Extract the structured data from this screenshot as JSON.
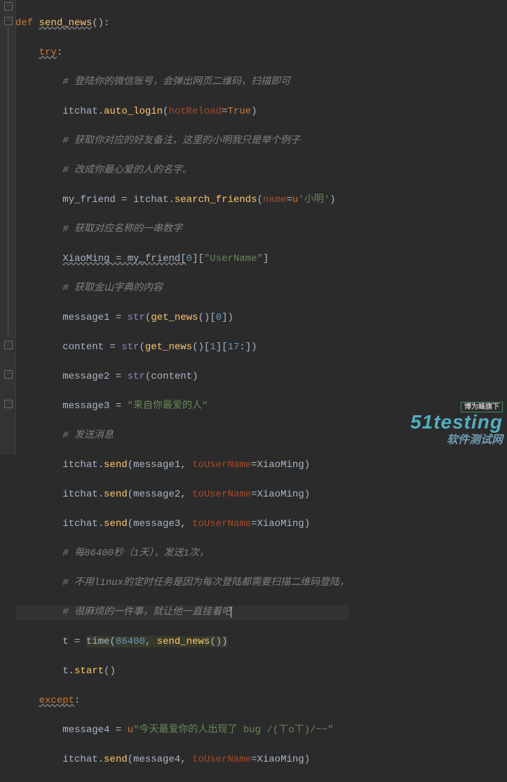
{
  "code": {
    "l1": {
      "kw": "def ",
      "fn": "send_news",
      "rest": "():"
    },
    "l2": {
      "kw": "try",
      "colon": ":"
    },
    "l3": "# 登陆你的微信账号，会弹出网页二维码，扫描即可",
    "l4": {
      "a": "itchat.",
      "fn": "auto_login",
      "b": "(",
      "p": "hotReload",
      "c": "=",
      "kw": "True",
      "d": ")"
    },
    "l5": "# 获取你对应的好友备注，这里的小明我只是举个例子",
    "l6": "# 改成你最心爱的人的名字。",
    "l7": {
      "a": "my_friend = itchat.",
      "fn": "search_friends",
      "b": "(",
      "p": "name",
      "c": "=",
      "kw": "u",
      "s": "'小明'",
      "d": ")"
    },
    "l8": "# 获取对应名称的一串数字",
    "l9": {
      "a": "XiaoMing = my_friend[",
      "n": "0",
      "b": "][",
      "s": "\"UserName\"",
      "c": "]"
    },
    "l10": "# 获取金山字典的内容",
    "l11": {
      "a": "message1 = ",
      "fn": "str",
      "b": "(",
      "fn2": "get_news",
      "c": "()[",
      "n": "0",
      "d": "])"
    },
    "l12": {
      "a": "content = ",
      "fn": "str",
      "b": "(",
      "fn2": "get_news",
      "c": "()[",
      "n1": "1",
      "d": "][",
      "n2": "17",
      "e": ":])"
    },
    "l13": {
      "a": "message2 = ",
      "fn": "str",
      "b": "(content)"
    },
    "l14": {
      "a": "message3 = ",
      "s": "\"来自你最爱的人\""
    },
    "l15": "# 发送消息",
    "l16": {
      "a": "itchat.",
      "fn": "send",
      "b": "(message1, ",
      "p": "toUserName",
      "c": "=XiaoMing)"
    },
    "l17": {
      "a": "itchat.",
      "fn": "send",
      "b": "(message2, ",
      "p": "toUserName",
      "c": "=XiaoMing)"
    },
    "l18": {
      "a": "itchat.",
      "fn": "send",
      "b": "(message3, ",
      "p": "toUserName",
      "c": "=XiaoMing)"
    },
    "l19": "# 每86400秒（1天），发送1次，",
    "l20": "# 不用linux的定时任务是因为每次登陆都需要扫描二维码登陆，",
    "l21": "# 很麻烦的一件事，就让他一直挂着吧",
    "l22": {
      "a": "t = ",
      "hl": "time(",
      "n": "86400",
      "b": ", ",
      "fn": "send_news",
      "c": "())"
    },
    "l23": {
      "a": "t.",
      "fn": "start",
      "b": "()"
    },
    "l24": {
      "kw": "except",
      "colon": ":"
    },
    "l25": {
      "a": "message4 = ",
      "kw": "u",
      "s": "\"今天最爱你的人出现了 bug /(ㄒoㄒ)/~~\""
    },
    "l26": {
      "a": "itchat.",
      "fn": "send",
      "b": "(message4, ",
      "p": "toUserName",
      "c": "=XiaoMing)"
    }
  },
  "watermark": {
    "badge": "博为峰旗下",
    "brand": "51testing",
    "sub": "软件测试网"
  }
}
